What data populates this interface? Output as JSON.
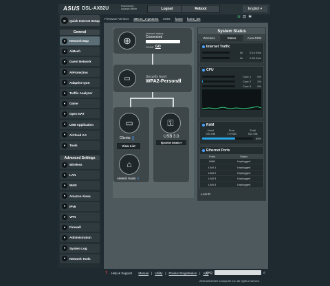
{
  "header": {
    "brand": "ASUS",
    "model": "DSL-AX82U",
    "powered_line1": "Powered by",
    "powered_line2": "Asuswrt-Merlin",
    "logout": "Logout",
    "reboot": "Reboot",
    "language": "English",
    "firmware_label": "Firmware Version:",
    "firmware_value": "386.01_2-gnuton1",
    "ssid_label": "SSID:",
    "ssid_value": "home",
    "ssid_value2": "home_5G"
  },
  "sidebar": {
    "quick_setup": "Quick Internet Setup",
    "general_heading": "General",
    "general_items": [
      {
        "label": "Network Map",
        "icon": "network-map-icon",
        "active": true
      },
      {
        "label": "AiMesh",
        "icon": "aimesh-icon"
      },
      {
        "label": "Guest Network",
        "icon": "guest-network-icon"
      },
      {
        "label": "AiProtection",
        "icon": "aiprotection-icon"
      },
      {
        "label": "Adaptive QoS",
        "icon": "qos-icon"
      },
      {
        "label": "Traffic Analyzer",
        "icon": "traffic-analyzer-icon"
      },
      {
        "label": "Game",
        "icon": "game-icon"
      },
      {
        "label": "Open NAT",
        "icon": "open-nat-icon"
      },
      {
        "label": "USB Application",
        "icon": "usb-application-icon"
      },
      {
        "label": "AiCloud 2.0",
        "icon": "aicloud-icon"
      },
      {
        "label": "Tools",
        "icon": "tools-icon"
      }
    ],
    "advanced_heading": "Advanced Settings",
    "advanced_items": [
      {
        "label": "Wireless",
        "icon": "wireless-icon"
      },
      {
        "label": "LAN",
        "icon": "lan-icon"
      },
      {
        "label": "WAN",
        "icon": "wan-icon"
      },
      {
        "label": "Amazon Alexa",
        "icon": "alexa-icon"
      },
      {
        "label": "IPv6",
        "icon": "ipv6-icon"
      },
      {
        "label": "VPN",
        "icon": "vpn-icon"
      },
      {
        "label": "Firewall",
        "icon": "firewall-icon"
      },
      {
        "label": "Administration",
        "icon": "administration-icon"
      },
      {
        "label": "System Log",
        "icon": "system-log-icon"
      },
      {
        "label": "Network Tools",
        "icon": "network-tools-icon"
      }
    ]
  },
  "netmap": {
    "internet_status_label": "Internet status:",
    "internet_status_value": "Connected",
    "ddns_label": "DDNS:",
    "ddns_value": "GO",
    "security_label": "Security level:",
    "security_value": "WPA2-Personal",
    "clients_label": "Clients:",
    "clients_value": "0",
    "view_list": "View List",
    "aimesh_label": "AiMesh Node:",
    "aimesh_value": "0",
    "usb_label": "USB 3.0",
    "usb_select": "Eject/Get Details"
  },
  "status": {
    "title": "System Status",
    "tabs": [
      "Wireless",
      "Status",
      "Aura RGB"
    ],
    "active_tab": 1,
    "internet_traffic": {
      "title": "Internet Traffic",
      "rows": [
        {
          "label": "0k",
          "value": "0.14 Kb/s"
        },
        {
          "label": "0k",
          "value": "0.36 Kb/s"
        }
      ]
    },
    "cpu": {
      "title": "CPU",
      "cores": [
        {
          "label": "Core 1",
          "value": "0%",
          "fraction": 0.0
        },
        {
          "label": "Core 2",
          "value": "2%",
          "fraction": 0.02
        },
        {
          "label": "Core 3",
          "value": "0%",
          "fraction": 0.0
        }
      ]
    },
    "ram": {
      "title": "RAM",
      "headers": [
        "Used",
        "Free",
        "Total"
      ],
      "values": [
        "333 MB",
        "179 MB",
        "512 MB"
      ],
      "percent": "65%",
      "fraction": 0.65
    },
    "ethernet": {
      "title": "Ethernet Ports",
      "columns": [
        "Ports",
        "Status"
      ],
      "rows": [
        [
          "WAN",
          "Unplugged"
        ],
        [
          "LAN 1",
          "Unplugged"
        ],
        [
          "LAN 2",
          "Unplugged"
        ],
        [
          "LAN 3",
          "Unplugged"
        ],
        [
          "LAN 4",
          "Unplugged"
        ]
      ]
    },
    "lan_ip_label": "LAN IP"
  },
  "footer": {
    "help": "Help & Support",
    "manual": "Manual",
    "utility": "Utility",
    "product_registration": "Product Registration",
    "app": "App",
    "faq": "FAQ",
    "copyright": "2020 ASUSTeK Computer Inc. All rights reserved."
  },
  "colors": {
    "accent": "#26a5e8",
    "background": "#1e2a30"
  }
}
